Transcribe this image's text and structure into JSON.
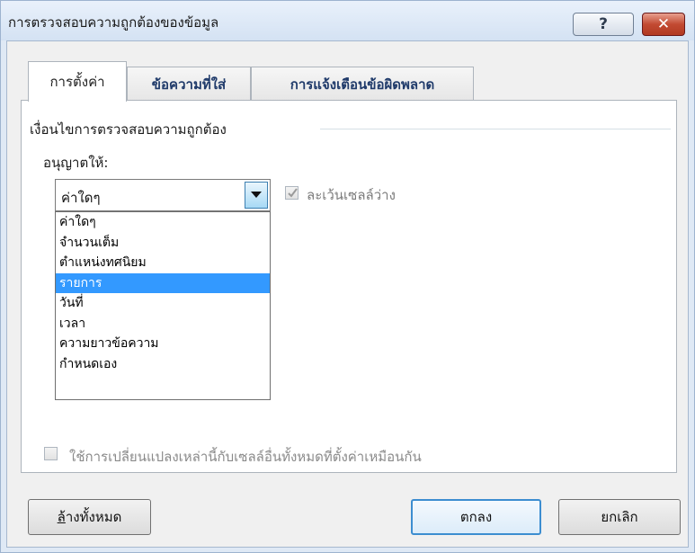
{
  "dialog": {
    "title": "การตรวจสอบความถูกต้องของข้อมูล",
    "help_symbol": "?",
    "close_symbol": "✕"
  },
  "tabs": [
    {
      "label": "การตั้งค่า"
    },
    {
      "label": "ข้อความที่ใส่"
    },
    {
      "label": "การแจ้งเตือนข้อผิดพลาด"
    }
  ],
  "settings": {
    "group_label": "เงื่อนไขการตรวจสอบความถูกต้อง",
    "allow_label_prefix": "อนุญาตให",
    "allow_label_mnemonic": "้",
    "allow_label_suffix": ":",
    "allow_value": "ค่าใดๆ",
    "allow_options": [
      "ค่าใดๆ",
      "จำนวนเต็ม",
      "ตำแหน่งทศนิยม",
      "รายการ",
      "วันที่",
      "เวลา",
      "ความยาวข้อความ",
      "กำหนดเอง"
    ],
    "highlighted_option": "รายการ",
    "ignore_blank_label": "ละเว้นเซลล์ว่าง",
    "ignore_blank_checked": true,
    "apply_all_label": "ใช้การเปลี่ยนแปลงเหล่านี้กับเซลล์อื่นทั้งหมดที่ตั้งค่าเหมือนกัน",
    "apply_all_checked": false
  },
  "buttons": {
    "clear_all_mnemonic": "ล",
    "clear_all_rest": "้างทั้งหมด",
    "ok": "ตกลง",
    "cancel": "ยกเลิก"
  }
}
